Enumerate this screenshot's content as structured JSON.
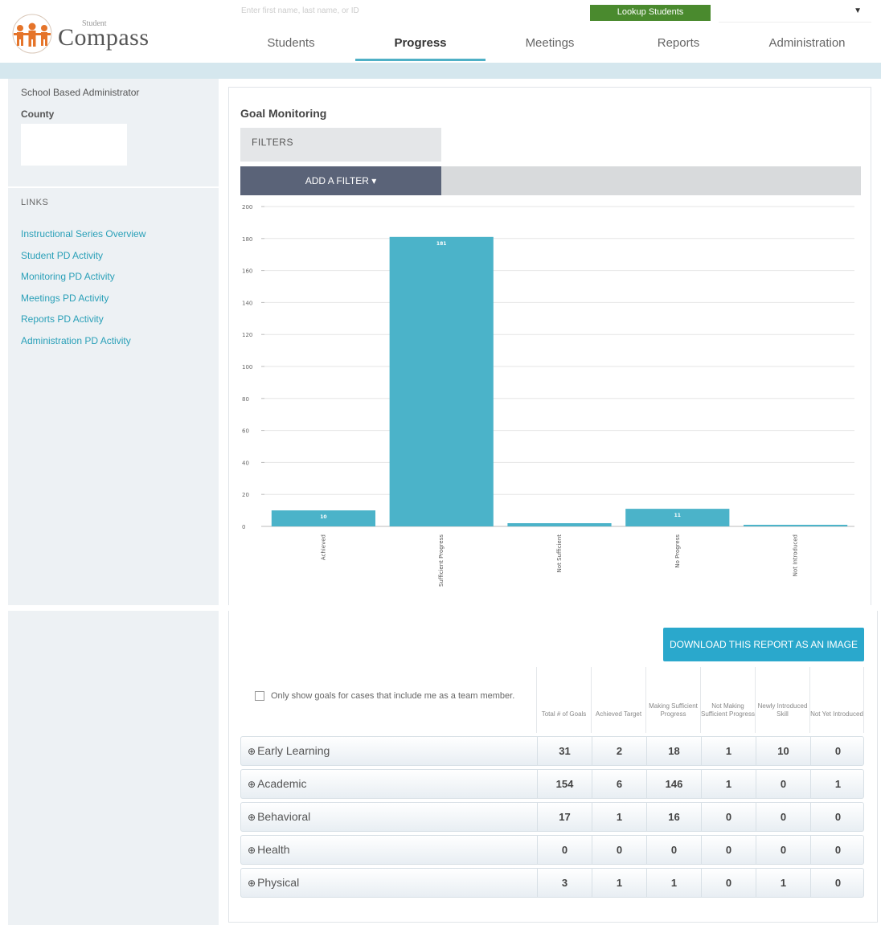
{
  "header": {
    "logo_small": "Student",
    "logo_big": "Compass",
    "search_placeholder": "Enter first name, last name, or ID",
    "lookup_button": "Lookup Students",
    "nav_tabs": [
      {
        "label": "Students",
        "active": false
      },
      {
        "label": "Progress",
        "active": true
      },
      {
        "label": "Meetings",
        "active": false
      },
      {
        "label": "Reports",
        "active": false
      },
      {
        "label": "Administration",
        "active": false
      }
    ]
  },
  "sidebar": {
    "role": "School Based Administrator",
    "county_label": "County",
    "links_heading": "LINKS",
    "links": [
      "Instructional Series Overview",
      "Student PD Activity",
      "Monitoring PD Activity",
      "Meetings PD Activity",
      "Reports PD Activity",
      "Administration PD Activity"
    ]
  },
  "main": {
    "title": "Goal Monitoring",
    "filters_label": "FILTERS",
    "add_filter_label": "ADD A FILTER ▾",
    "download_button": "DOWNLOAD THIS REPORT AS AN IMAGE",
    "only_show_label": "Only show goals for cases that include me as a team member."
  },
  "chart_data": {
    "type": "bar",
    "categories": [
      "Achieved",
      "Sufficient Progress",
      "Not Sufficient",
      "No Progress",
      "Not Introduced"
    ],
    "values": [
      10,
      181,
      2,
      11,
      1
    ],
    "value_labels": [
      "10",
      "181",
      "",
      "11",
      ""
    ],
    "ylim": [
      0,
      200
    ],
    "yticks": [
      0,
      20,
      40,
      60,
      80,
      100,
      120,
      140,
      160,
      180,
      200
    ],
    "grid": true,
    "bar_color": "#4bb3c9"
  },
  "table": {
    "columns": [
      "Total # of Goals",
      "Achieved Target",
      "Making Sufficient Progress",
      "Not Making Sufficient Progress",
      "Newly Introduced Skill",
      "Not Yet Introduced"
    ],
    "rows": [
      {
        "category": "Early Learning",
        "values": [
          "31",
          "2",
          "18",
          "1",
          "10",
          "0"
        ]
      },
      {
        "category": "Academic",
        "values": [
          "154",
          "6",
          "146",
          "1",
          "0",
          "1"
        ]
      },
      {
        "category": "Behavioral",
        "values": [
          "17",
          "1",
          "16",
          "0",
          "0",
          "0"
        ]
      },
      {
        "category": "Health",
        "values": [
          "0",
          "0",
          "0",
          "0",
          "0",
          "0"
        ]
      },
      {
        "category": "Physical",
        "values": [
          "3",
          "1",
          "1",
          "0",
          "1",
          "0"
        ]
      }
    ]
  },
  "colors": {
    "accent": "#2aa8cc",
    "link": "#2aa0b8",
    "lookup": "#4a8a2e",
    "filter_button": "#5a6378"
  }
}
